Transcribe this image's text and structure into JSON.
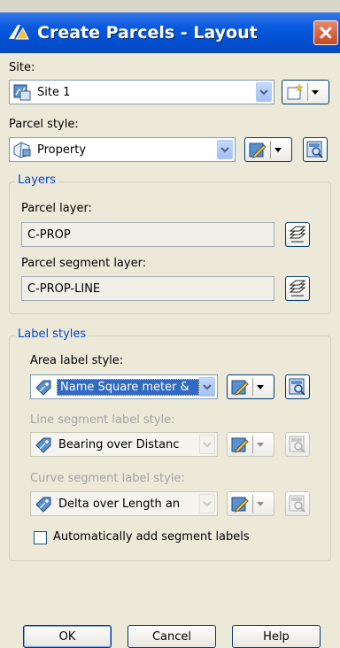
{
  "window": {
    "title": "Create Parcels - Layout"
  },
  "site": {
    "label": "Site:",
    "value": "Site 1"
  },
  "parcel_style": {
    "label": "Parcel style:",
    "value": "Property"
  },
  "layers": {
    "legend": "Layers",
    "parcel_layer_label": "Parcel layer:",
    "parcel_layer_value": "C-PROP",
    "segment_layer_label": "Parcel segment layer:",
    "segment_layer_value": "C-PROP-LINE"
  },
  "label_styles": {
    "legend": "Label styles",
    "area_label": "Area label style:",
    "area_value": "Name Square meter &",
    "line_label": "Line segment label style:",
    "line_value": "Bearing over Distanc",
    "curve_label": "Curve segment label style:",
    "curve_value": "Delta over Length an",
    "auto_add_label": "Automatically add segment labels",
    "auto_add_checked": false
  },
  "buttons": {
    "ok": "OK",
    "cancel": "Cancel",
    "help": "Help"
  },
  "colors": {
    "titlebar": "#0150d0",
    "close": "#c9471f",
    "group_legend": "#0046d5",
    "selection": "#316ac5",
    "disabled_text": "#a3a3a3",
    "dialog_bg": "#ece9d8"
  },
  "icons": {
    "app": "civil-3d-app-icon",
    "site": "site-icon",
    "parcel_style": "parcel-style-icon",
    "label_style": "label-style-icon",
    "edit": "edit-style-icon",
    "detail": "style-detail-icon",
    "layer": "layer-stack-icon",
    "new": "create-new-icon",
    "close": "close-icon"
  }
}
